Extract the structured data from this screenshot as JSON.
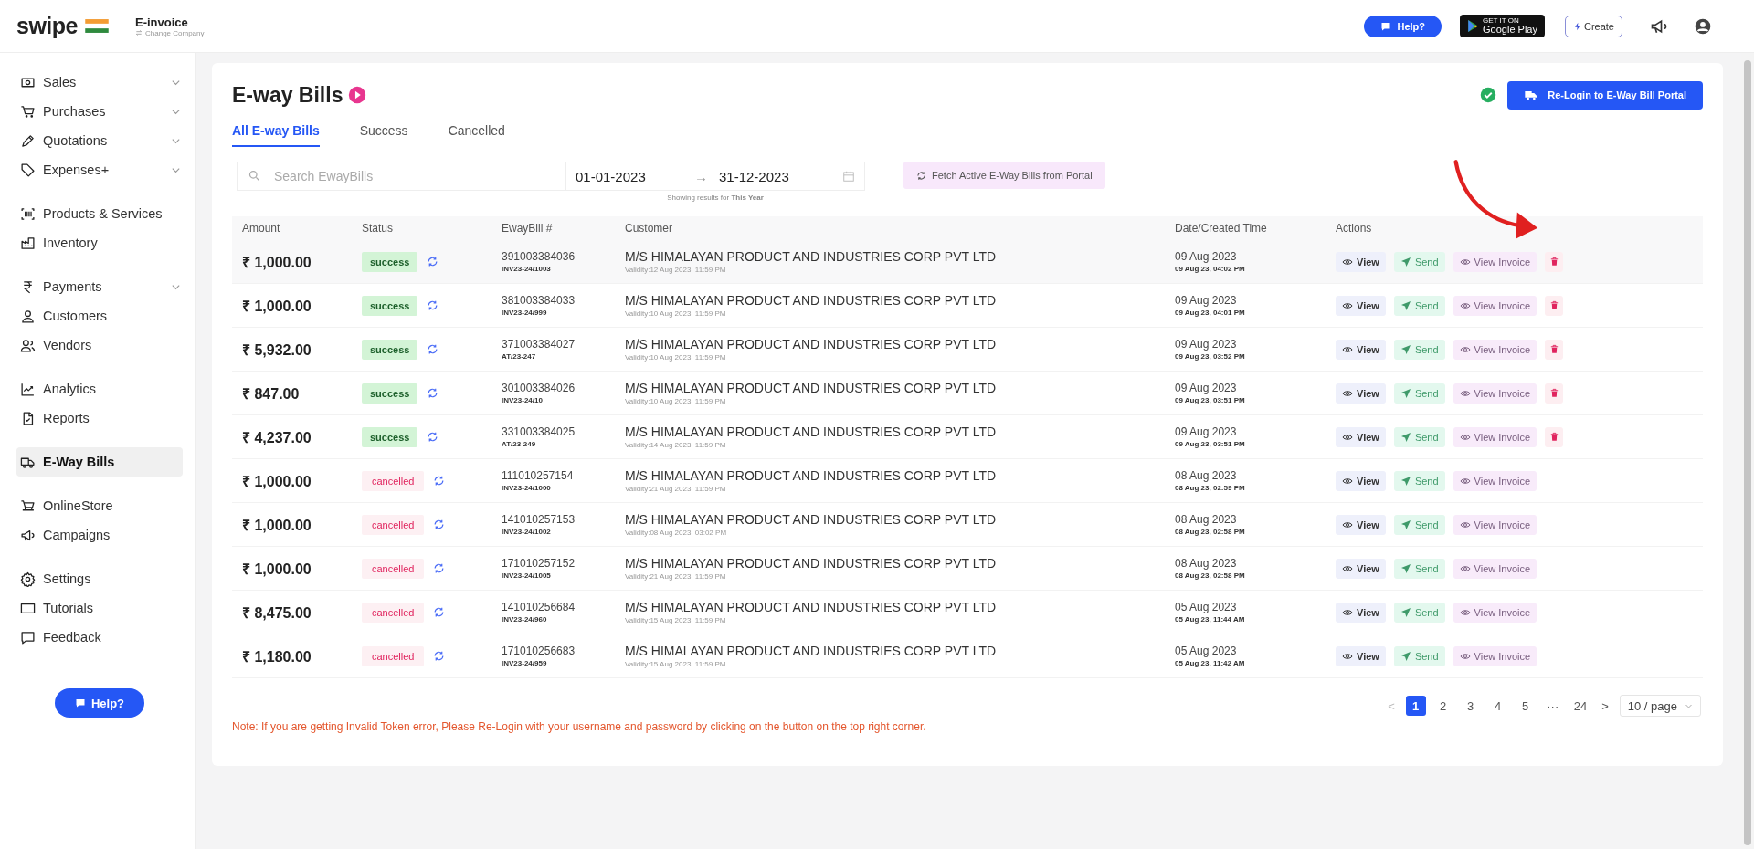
{
  "header": {
    "logo": "swipe",
    "company": "E-invoice",
    "company_action": "Change Company",
    "help": "Help?",
    "store_badge": {
      "small": "GET IT ON",
      "large": "Google Play"
    },
    "create": "Create"
  },
  "sidebar": {
    "groups": [
      {
        "items": [
          {
            "label": "Sales",
            "expandable": true,
            "selected": false
          },
          {
            "label": "Purchases",
            "expandable": true,
            "selected": false
          },
          {
            "label": "Quotations",
            "expandable": true,
            "selected": false
          },
          {
            "label": "Expenses+",
            "expandable": true,
            "selected": false
          }
        ]
      },
      {
        "items": [
          {
            "label": "Products & Services",
            "expandable": false,
            "selected": false
          },
          {
            "label": "Inventory",
            "expandable": false,
            "selected": false
          }
        ]
      },
      {
        "items": [
          {
            "label": "Payments",
            "expandable": true,
            "selected": false
          },
          {
            "label": "Customers",
            "expandable": false,
            "selected": false
          },
          {
            "label": "Vendors",
            "expandable": false,
            "selected": false
          }
        ]
      },
      {
        "items": [
          {
            "label": "Analytics",
            "expandable": false,
            "selected": false
          },
          {
            "label": "Reports",
            "expandable": false,
            "selected": false
          }
        ]
      },
      {
        "items": [
          {
            "label": "E-Way Bills",
            "expandable": false,
            "selected": true
          }
        ]
      },
      {
        "items": [
          {
            "label": "OnlineStore",
            "expandable": false,
            "selected": false
          },
          {
            "label": "Campaigns",
            "expandable": false,
            "selected": false
          }
        ]
      },
      {
        "items": [
          {
            "label": "Settings",
            "expandable": false,
            "selected": false
          },
          {
            "label": "Tutorials",
            "expandable": false,
            "selected": false
          },
          {
            "label": "Feedback",
            "expandable": false,
            "selected": false
          }
        ]
      }
    ],
    "help": "Help?"
  },
  "page": {
    "title": "E-way Bills",
    "relogin": "Re-Login to E-Way Bill Portal",
    "connected": true,
    "tabs": [
      {
        "label": "All E-way Bills",
        "selected": true
      },
      {
        "label": "Success",
        "selected": false
      },
      {
        "label": "Cancelled",
        "selected": false
      }
    ],
    "search": {
      "placeholder": "Search EwayBills"
    },
    "date_from": "01-01-2023",
    "date_to": "31-12-2023",
    "range_arrow": "→",
    "range_note": "Showing results for **This Year**",
    "fetch": "Fetch Active E-Way Bills from Portal"
  },
  "table": {
    "columns": [
      "Amount",
      "Status",
      "EwayBill #",
      "Customer",
      "Date/Created Time",
      "Actions"
    ],
    "rows": [
      {
        "amount": "₹ 1,000.00",
        "status": "success",
        "kind": "success",
        "eway_no": "391003384036",
        "invoice_no": "INV23-24/1003",
        "customer": "M/S HIMALAYAN PRODUCT AND INDUSTRIES CORP PVT LTD",
        "validity": "Validity:12 Aug 2023, 11:59 PM",
        "date": "09 Aug 2023",
        "created": "09 Aug 23, 04:02 PM",
        "actions": [
          "View",
          "Send",
          "View Invoice"
        ],
        "deletable": true,
        "highlighted": true
      },
      {
        "amount": "₹ 1,000.00",
        "status": "success",
        "kind": "success",
        "eway_no": "381003384033",
        "invoice_no": "INV23-24/999",
        "customer": "M/S HIMALAYAN PRODUCT AND INDUSTRIES CORP PVT LTD",
        "validity": "Validity:10 Aug 2023, 11:59 PM",
        "date": "09 Aug 2023",
        "created": "09 Aug 23, 04:01 PM",
        "actions": [
          "View",
          "Send",
          "View Invoice"
        ],
        "deletable": true,
        "highlighted": false
      },
      {
        "amount": "₹ 5,932.00",
        "status": "success",
        "kind": "success",
        "eway_no": "371003384027",
        "invoice_no": "AT/23-247",
        "customer": "M/S HIMALAYAN PRODUCT AND INDUSTRIES CORP PVT LTD",
        "validity": "Validity:10 Aug 2023, 11:59 PM",
        "date": "09 Aug 2023",
        "created": "09 Aug 23, 03:52 PM",
        "actions": [
          "View",
          "Send",
          "View Invoice"
        ],
        "deletable": true,
        "highlighted": false
      },
      {
        "amount": "₹ 847.00",
        "status": "success",
        "kind": "success",
        "eway_no": "301003384026",
        "invoice_no": "INV23-24/10",
        "customer": "M/S HIMALAYAN PRODUCT AND INDUSTRIES CORP PVT LTD",
        "validity": "Validity:10 Aug 2023, 11:59 PM",
        "date": "09 Aug 2023",
        "created": "09 Aug 23, 03:51 PM",
        "actions": [
          "View",
          "Send",
          "View Invoice"
        ],
        "deletable": true,
        "highlighted": false
      },
      {
        "amount": "₹ 4,237.00",
        "status": "success",
        "kind": "success",
        "eway_no": "331003384025",
        "invoice_no": "AT/23-249",
        "customer": "M/S HIMALAYAN PRODUCT AND INDUSTRIES CORP PVT LTD",
        "validity": "Validity:14 Aug 2023, 11:59 PM",
        "date": "09 Aug 2023",
        "created": "09 Aug 23, 03:51 PM",
        "actions": [
          "View",
          "Send",
          "View Invoice"
        ],
        "deletable": true,
        "highlighted": false
      },
      {
        "amount": "₹ 1,000.00",
        "status": "cancelled",
        "kind": "cancelled",
        "eway_no": "111010257154",
        "invoice_no": "INV23-24/1000",
        "customer": "M/S HIMALAYAN PRODUCT AND INDUSTRIES CORP PVT LTD",
        "validity": "Validity:21 Aug 2023, 11:59 PM",
        "date": "08 Aug 2023",
        "created": "08 Aug 23, 02:59 PM",
        "actions": [
          "View",
          "Send",
          "View Invoice"
        ],
        "deletable": false,
        "highlighted": false
      },
      {
        "amount": "₹ 1,000.00",
        "status": "cancelled",
        "kind": "cancelled",
        "eway_no": "141010257153",
        "invoice_no": "INV23-24/1002",
        "customer": "M/S HIMALAYAN PRODUCT AND INDUSTRIES CORP PVT LTD",
        "validity": "Validity:08 Aug 2023, 03:02 PM",
        "date": "08 Aug 2023",
        "created": "08 Aug 23, 02:58 PM",
        "actions": [
          "View",
          "Send",
          "View Invoice"
        ],
        "deletable": false,
        "highlighted": false
      },
      {
        "amount": "₹ 1,000.00",
        "status": "cancelled",
        "kind": "cancelled",
        "eway_no": "171010257152",
        "invoice_no": "INV23-24/1005",
        "customer": "M/S HIMALAYAN PRODUCT AND INDUSTRIES CORP PVT LTD",
        "validity": "Validity:21 Aug 2023, 11:59 PM",
        "date": "08 Aug 2023",
        "created": "08 Aug 23, 02:58 PM",
        "actions": [
          "View",
          "Send",
          "View Invoice"
        ],
        "deletable": false,
        "highlighted": false
      },
      {
        "amount": "₹ 8,475.00",
        "status": "cancelled",
        "kind": "cancelled",
        "eway_no": "141010256684",
        "invoice_no": "INV23-24/960",
        "customer": "M/S HIMALAYAN PRODUCT AND INDUSTRIES CORP PVT LTD",
        "validity": "Validity:15 Aug 2023, 11:59 PM",
        "date": "05 Aug 2023",
        "created": "05 Aug 23, 11:44 AM",
        "actions": [
          "View",
          "Send",
          "View Invoice"
        ],
        "deletable": false,
        "highlighted": false
      },
      {
        "amount": "₹ 1,180.00",
        "status": "cancelled",
        "kind": "cancelled",
        "eway_no": "171010256683",
        "invoice_no": "INV23-24/959",
        "customer": "M/S HIMALAYAN PRODUCT AND INDUSTRIES CORP PVT LTD",
        "validity": "Validity:15 Aug 2023, 11:59 PM",
        "date": "05 Aug 2023",
        "created": "05 Aug 23, 11:42 AM",
        "actions": [
          "View",
          "Send",
          "View Invoice"
        ],
        "deletable": false,
        "highlighted": false
      }
    ]
  },
  "pagination": {
    "prev": "<",
    "pages": [
      {
        "label": "1",
        "selected": true
      },
      {
        "label": "2",
        "selected": false
      },
      {
        "label": "3",
        "selected": false
      },
      {
        "label": "4",
        "selected": false
      },
      {
        "label": "5",
        "selected": false
      },
      {
        "label": "···",
        "selected": false
      },
      {
        "label": "24",
        "selected": false
      }
    ],
    "next": ">",
    "page_size": "10 / page"
  },
  "note": "Note: If you are getting Invalid Token error, Please Re-Login with your username and password by clicking on the button on the top right corner."
}
